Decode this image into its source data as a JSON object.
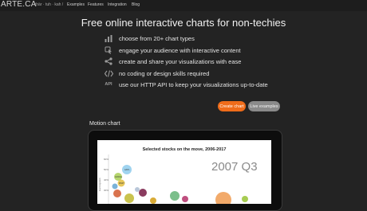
{
  "header": {
    "logo": "ARTE.CA",
    "tagline": "/ chär · tuh · kah /",
    "nav": [
      "Examples",
      "Features",
      "Integration",
      "Blog"
    ]
  },
  "hero": {
    "title": "Free online interactive charts for non-techies"
  },
  "features": [
    {
      "icon": "chart-bars-icon",
      "text": "choose from 20+ chart types"
    },
    {
      "icon": "pointer-hand-icon",
      "text": "engage your audience with interactive content"
    },
    {
      "icon": "share-icon",
      "text": "create and share your visualizations with ease"
    },
    {
      "icon": "code-brackets-icon",
      "text": "no coding or design skills required"
    },
    {
      "icon": "api-icon",
      "text": "use our HTTP API to keep your visualizations up-to-date",
      "icon_text": "API"
    }
  ],
  "buttons": {
    "create": "Create chart",
    "live": "Live examples"
  },
  "section": {
    "label": "Motion chart"
  },
  "preview": {
    "title": "Selected stocks on the move, 2006-2017",
    "big_label": "2007 Q3",
    "y_ticks": [
      "60%",
      "50%",
      "40%",
      "30%"
    ],
    "ylabel": "Earnings/p/s",
    "bubble_labels": [
      "AAPL",
      "GOOGL",
      "MSFT"
    ]
  },
  "colors": {
    "background": "#232323",
    "accent": "#ef6c1a",
    "secondary_button": "#8a8a8a"
  }
}
